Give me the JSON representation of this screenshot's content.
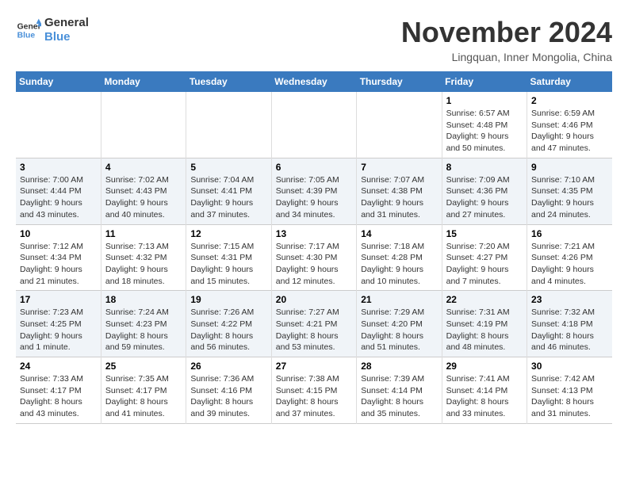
{
  "logo": {
    "line1": "General",
    "line2": "Blue"
  },
  "title": "November 2024",
  "location": "Lingquan, Inner Mongolia, China",
  "weekdays": [
    "Sunday",
    "Monday",
    "Tuesday",
    "Wednesday",
    "Thursday",
    "Friday",
    "Saturday"
  ],
  "weeks": [
    [
      {
        "day": "",
        "info": ""
      },
      {
        "day": "",
        "info": ""
      },
      {
        "day": "",
        "info": ""
      },
      {
        "day": "",
        "info": ""
      },
      {
        "day": "",
        "info": ""
      },
      {
        "day": "1",
        "info": "Sunrise: 6:57 AM\nSunset: 4:48 PM\nDaylight: 9 hours and 50 minutes."
      },
      {
        "day": "2",
        "info": "Sunrise: 6:59 AM\nSunset: 4:46 PM\nDaylight: 9 hours and 47 minutes."
      }
    ],
    [
      {
        "day": "3",
        "info": "Sunrise: 7:00 AM\nSunset: 4:44 PM\nDaylight: 9 hours and 43 minutes."
      },
      {
        "day": "4",
        "info": "Sunrise: 7:02 AM\nSunset: 4:43 PM\nDaylight: 9 hours and 40 minutes."
      },
      {
        "day": "5",
        "info": "Sunrise: 7:04 AM\nSunset: 4:41 PM\nDaylight: 9 hours and 37 minutes."
      },
      {
        "day": "6",
        "info": "Sunrise: 7:05 AM\nSunset: 4:39 PM\nDaylight: 9 hours and 34 minutes."
      },
      {
        "day": "7",
        "info": "Sunrise: 7:07 AM\nSunset: 4:38 PM\nDaylight: 9 hours and 31 minutes."
      },
      {
        "day": "8",
        "info": "Sunrise: 7:09 AM\nSunset: 4:36 PM\nDaylight: 9 hours and 27 minutes."
      },
      {
        "day": "9",
        "info": "Sunrise: 7:10 AM\nSunset: 4:35 PM\nDaylight: 9 hours and 24 minutes."
      }
    ],
    [
      {
        "day": "10",
        "info": "Sunrise: 7:12 AM\nSunset: 4:34 PM\nDaylight: 9 hours and 21 minutes."
      },
      {
        "day": "11",
        "info": "Sunrise: 7:13 AM\nSunset: 4:32 PM\nDaylight: 9 hours and 18 minutes."
      },
      {
        "day": "12",
        "info": "Sunrise: 7:15 AM\nSunset: 4:31 PM\nDaylight: 9 hours and 15 minutes."
      },
      {
        "day": "13",
        "info": "Sunrise: 7:17 AM\nSunset: 4:30 PM\nDaylight: 9 hours and 12 minutes."
      },
      {
        "day": "14",
        "info": "Sunrise: 7:18 AM\nSunset: 4:28 PM\nDaylight: 9 hours and 10 minutes."
      },
      {
        "day": "15",
        "info": "Sunrise: 7:20 AM\nSunset: 4:27 PM\nDaylight: 9 hours and 7 minutes."
      },
      {
        "day": "16",
        "info": "Sunrise: 7:21 AM\nSunset: 4:26 PM\nDaylight: 9 hours and 4 minutes."
      }
    ],
    [
      {
        "day": "17",
        "info": "Sunrise: 7:23 AM\nSunset: 4:25 PM\nDaylight: 9 hours and 1 minute."
      },
      {
        "day": "18",
        "info": "Sunrise: 7:24 AM\nSunset: 4:23 PM\nDaylight: 8 hours and 59 minutes."
      },
      {
        "day": "19",
        "info": "Sunrise: 7:26 AM\nSunset: 4:22 PM\nDaylight: 8 hours and 56 minutes."
      },
      {
        "day": "20",
        "info": "Sunrise: 7:27 AM\nSunset: 4:21 PM\nDaylight: 8 hours and 53 minutes."
      },
      {
        "day": "21",
        "info": "Sunrise: 7:29 AM\nSunset: 4:20 PM\nDaylight: 8 hours and 51 minutes."
      },
      {
        "day": "22",
        "info": "Sunrise: 7:31 AM\nSunset: 4:19 PM\nDaylight: 8 hours and 48 minutes."
      },
      {
        "day": "23",
        "info": "Sunrise: 7:32 AM\nSunset: 4:18 PM\nDaylight: 8 hours and 46 minutes."
      }
    ],
    [
      {
        "day": "24",
        "info": "Sunrise: 7:33 AM\nSunset: 4:17 PM\nDaylight: 8 hours and 43 minutes."
      },
      {
        "day": "25",
        "info": "Sunrise: 7:35 AM\nSunset: 4:17 PM\nDaylight: 8 hours and 41 minutes."
      },
      {
        "day": "26",
        "info": "Sunrise: 7:36 AM\nSunset: 4:16 PM\nDaylight: 8 hours and 39 minutes."
      },
      {
        "day": "27",
        "info": "Sunrise: 7:38 AM\nSunset: 4:15 PM\nDaylight: 8 hours and 37 minutes."
      },
      {
        "day": "28",
        "info": "Sunrise: 7:39 AM\nSunset: 4:14 PM\nDaylight: 8 hours and 35 minutes."
      },
      {
        "day": "29",
        "info": "Sunrise: 7:41 AM\nSunset: 4:14 PM\nDaylight: 8 hours and 33 minutes."
      },
      {
        "day": "30",
        "info": "Sunrise: 7:42 AM\nSunset: 4:13 PM\nDaylight: 8 hours and 31 minutes."
      }
    ]
  ]
}
